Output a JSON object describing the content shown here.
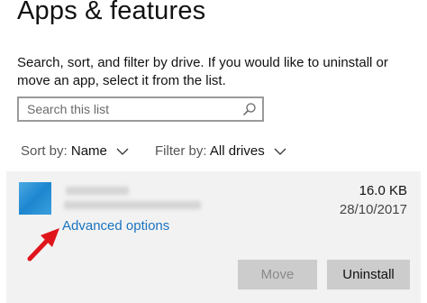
{
  "page": {
    "title": "Apps & features",
    "description": "Search, sort, and filter by drive. If you would like to uninstall or move an app, select it from the list."
  },
  "search": {
    "placeholder": "Search this list",
    "icon": "search-icon"
  },
  "sort": {
    "label": "Sort by:",
    "value": "Name"
  },
  "filter": {
    "label": "Filter by:",
    "value": "All drives"
  },
  "app": {
    "size": "16.0 KB",
    "date": "28/10/2017",
    "advanced_options": "Advanced options",
    "icon_color": "#1c86cf"
  },
  "buttons": {
    "move": "Move",
    "uninstall": "Uninstall"
  },
  "colors": {
    "link": "#1a73c0",
    "annotation_arrow": "#e0141b"
  }
}
